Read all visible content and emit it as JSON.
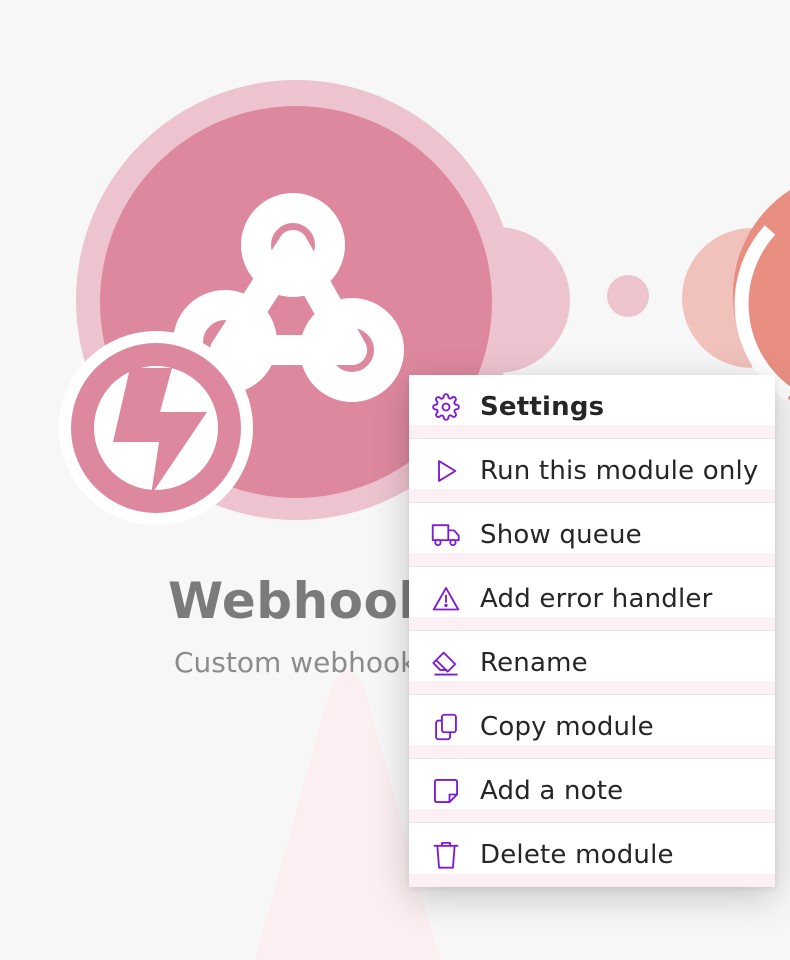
{
  "module": {
    "title": "Webhooks",
    "subtitle": "Custom webhook",
    "brand_color": "#de889f",
    "icon": "webhook-icon",
    "trigger_icon": "lightning-icon"
  },
  "context_menu": {
    "icon_color": "#7d1bd6",
    "items": [
      {
        "label": "Settings",
        "icon": "gear-icon",
        "bold": true
      },
      {
        "label": "Run this module only",
        "icon": "play-icon"
      },
      {
        "label": "Show queue",
        "icon": "truck-icon"
      },
      {
        "label": "Add error handler",
        "icon": "warning-icon"
      },
      {
        "label": "Rename",
        "icon": "eraser-icon"
      },
      {
        "label": "Copy module",
        "icon": "copy-icon"
      },
      {
        "label": "Add a note",
        "icon": "note-icon"
      },
      {
        "label": "Delete module",
        "icon": "trash-icon"
      }
    ]
  }
}
